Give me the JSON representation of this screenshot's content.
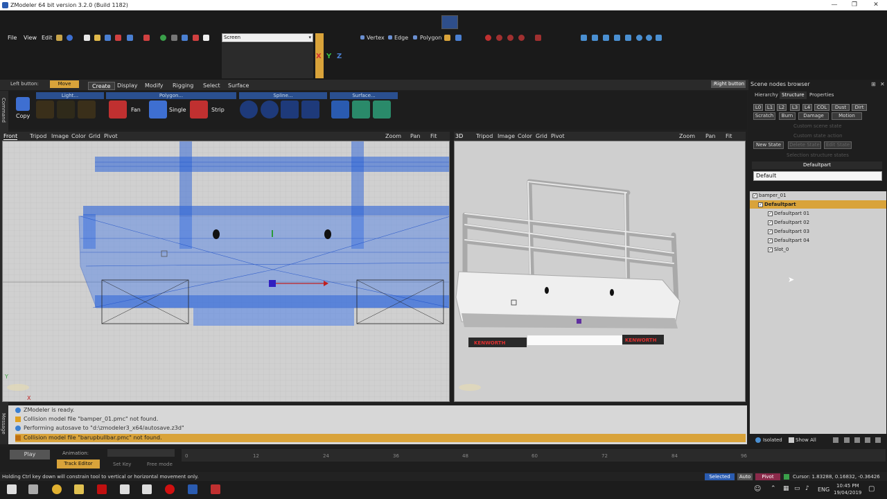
{
  "window": {
    "title": "ZModeler 64 bit version 3.2.0 (Build 1182)"
  },
  "menu": [
    "File",
    "View",
    "Edit"
  ],
  "toolbar": {
    "screen_select": "Screen",
    "axes": [
      "X",
      "Y",
      "Z"
    ],
    "select_modes": [
      "Vertex",
      "Edge",
      "Polygon"
    ]
  },
  "leftbar": {
    "left_button_label": "Left button:",
    "move_label": "Move",
    "right_button_label": ":Right button"
  },
  "tabs": [
    "Create",
    "Display",
    "Modify",
    "Rigging",
    "Select",
    "Surface"
  ],
  "create": {
    "side_label": "Command",
    "groups": [
      "Light...",
      "Polygon...",
      "Spline...",
      "Surface..."
    ],
    "copy_label": "Copy",
    "fan_label": "Fan",
    "single_label": "Single",
    "strip_label": "Strip"
  },
  "viewport_front": {
    "name": "Front",
    "items": [
      "Tripod",
      "Image",
      "Color",
      "Grid",
      "Pivot"
    ],
    "zoom": "Zoom",
    "pan": "Pan",
    "fit": "Fit"
  },
  "viewport_3d": {
    "name": "3D",
    "items": [
      "Tripod",
      "Image",
      "Color",
      "Grid",
      "Pivot"
    ],
    "zoom": "Zoom",
    "pan": "Pan",
    "fit": "Fit",
    "plate_text": "KENWORTH"
  },
  "scene": {
    "title": "Scene nodes browser",
    "tabs": [
      "Hierarchy",
      "Structure",
      "Properties"
    ],
    "lods": [
      "L0",
      "L1",
      "L2",
      "L3",
      "L4",
      "COL",
      "Dust",
      "Dirt"
    ],
    "row2": [
      "Scratch",
      "Burn",
      "Damage",
      "Motion"
    ],
    "new_state": "New State",
    "delete_state": "Delete State",
    "edit_state": "Edit State",
    "custom_scene_state": "Custom scene state",
    "custom_state_action": "Custom state action",
    "selection_structure_states": "Selection structure states",
    "defaultpart_header": "Defaultpart",
    "default_value": "Default",
    "tree": [
      {
        "label": "bamper_01",
        "indent": 0,
        "selected": false
      },
      {
        "label": "Defaultpart",
        "indent": 1,
        "selected": true
      },
      {
        "label": "Defaultpart 01",
        "indent": 2,
        "selected": false
      },
      {
        "label": "Defaultpart 02",
        "indent": 2,
        "selected": false
      },
      {
        "label": "Defaultpart 03",
        "indent": 2,
        "selected": false
      },
      {
        "label": "Defaultpart 04",
        "indent": 2,
        "selected": false
      },
      {
        "label": "Slot_0",
        "indent": 2,
        "selected": false
      }
    ],
    "isolated": "Isolated",
    "show_all": "Show All"
  },
  "messages": {
    "side_label": "Message",
    "items": [
      {
        "text": "ZModeler is ready.",
        "level": "info"
      },
      {
        "text": "Collision model file \"bamper_01.pmc\" not found.",
        "level": "warn"
      },
      {
        "text": "Performing autosave to \"d:\\zmodeler3_x64/autosave.z3d\"",
        "level": "info"
      },
      {
        "text": "Collision model file \"barupbullbar.pmc\" not found.",
        "level": "warn-hl"
      }
    ]
  },
  "animation": {
    "play": "Play",
    "animation_label": "Animation:",
    "track_editor": "Track Editor",
    "set_key": "Set Key",
    "free_mode": "Free mode",
    "ticks": [
      "0",
      "12",
      "24",
      "36",
      "48",
      "60",
      "72",
      "84",
      "96"
    ]
  },
  "status": {
    "hint": "Holding Ctrl key down will constrain tool to vertical or horizontal movement only.",
    "selected": "Selected",
    "auto": "Auto",
    "pivot": "Pivot",
    "cursor": "Cursor: 1.83288, 0.16832, -0.36426"
  },
  "taskbar": {
    "language": "ENG",
    "time": "10:45 PM",
    "date": "19/04/2019"
  }
}
